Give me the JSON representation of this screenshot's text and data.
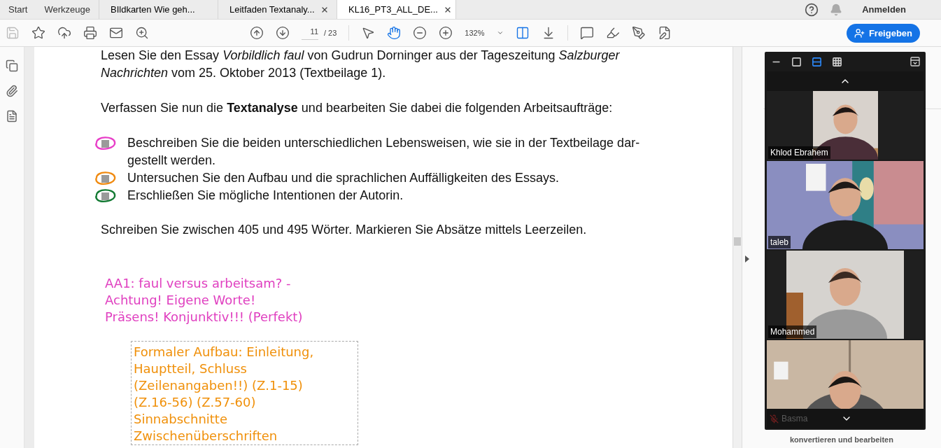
{
  "tabs": [
    {
      "label": "Start",
      "kind": "home",
      "selected": false,
      "closable": false
    },
    {
      "label": "Werkzeuge",
      "kind": "home",
      "selected": false,
      "closable": false
    },
    {
      "label": "BIldkarten Wie geh...",
      "kind": "document",
      "selected": false,
      "closable": false
    },
    {
      "label": "Leitfaden Textanaly...",
      "kind": "document",
      "selected": false,
      "closable": true
    },
    {
      "label": "KL16_PT3_ALL_DE...",
      "kind": "document",
      "selected": true,
      "closable": true
    }
  ],
  "account": {
    "sign_in": "Anmelden"
  },
  "toolbar": {
    "page_current": "11",
    "page_total": "/ 23",
    "zoom": "132%",
    "share_button": "Freigeben",
    "hand_tool_selected": true
  },
  "document": {
    "intro": "Lesen Sie den Essay *Vorbildlich faul* von Gudrun Dorninger aus der Tageszeitung *Salzburger Nachrichten* vom 25. Oktober 2013 (Textbeilage 1).",
    "task_line": "Verfassen Sie nun die **Textanalyse** und bearbeiten Sie dabei die folgenden Arbeitsaufträge:",
    "tasks": [
      {
        "text": "Beschreiben Sie die beiden unterschiedlichen Lebensweisen, wie sie in der Textbeilage dar-gestellt werden.",
        "color": "#e83ec8",
        "checked": false
      },
      {
        "text": "Untersuchen Sie den Aufbau und die sprachlichen Auffälligkeiten des Essays.",
        "color": "#f08a10",
        "checked": false
      },
      {
        "text": "Erschließen Sie mögliche Intentionen der Autorin.",
        "color": "#137a33",
        "checked": false
      }
    ],
    "word_count_line": "Schreiben Sie zwischen 405 und 495 Wörter. Markieren Sie Absätze mittels Leerzeilen.",
    "annotations": [
      {
        "kind": "note",
        "color": "#e040c0",
        "lines": [
          "AA1: faul versus arbeitsam? -",
          "Achtung! Eigene Worte!",
          "Präsens! Konjunktiv!!! (Perfekt)"
        ]
      },
      {
        "kind": "textbox",
        "color": "#f0900a",
        "lines": [
          "Formaler Aufbau: Einleitung,",
          "Hauptteil, Schluss",
          "(Zeilenangaben!!) (Z.1-15)",
          "(Z.16-56) (Z.57-60)",
          "Sinnabschnitte",
          "Zwischenüberschriften"
        ]
      }
    ]
  },
  "right_pane": {
    "footer": "konvertieren und bearbeiten"
  },
  "video_panel": {
    "views": [
      {
        "kind": "minimize",
        "selected": false
      },
      {
        "kind": "single",
        "selected": false
      },
      {
        "kind": "strip",
        "selected": true
      },
      {
        "kind": "grid",
        "selected": false
      }
    ],
    "participants": [
      {
        "name": "Khlod Ebrahem",
        "kind": "portrait"
      },
      {
        "name": "taleb",
        "kind": "landscape"
      },
      {
        "name": "Mohammed",
        "kind": "portrait"
      },
      {
        "name": "Basma",
        "kind": "landscape"
      }
    ]
  }
}
